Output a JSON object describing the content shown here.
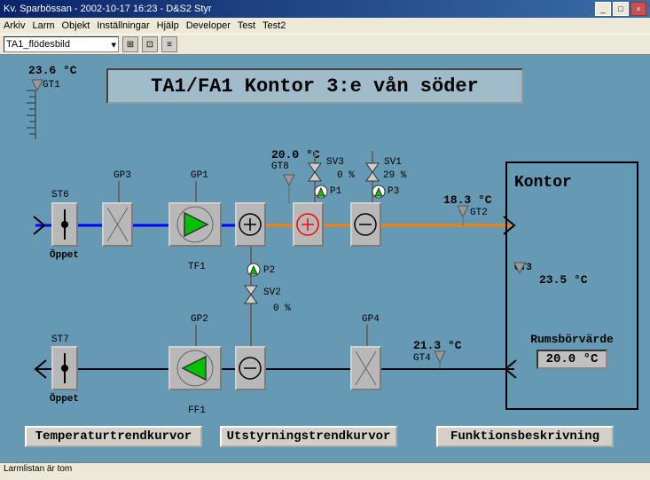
{
  "window": {
    "title": "Kv. Sparbössan  -  2002-10-17 16:23  -  D&S2 Styr",
    "min": "_",
    "max": "□",
    "close": "×"
  },
  "menu": [
    "Arkiv",
    "Larm",
    "Objekt",
    "Inställningar",
    "Hjälp",
    "Developer",
    "Test",
    "Test2"
  ],
  "toolbar": {
    "combo": "TA1_flödesbild",
    "combo_arrow": "▾"
  },
  "title": "TA1/FA1 Kontor 3:e vån söder",
  "outdoor": {
    "temp": "23.6 °C",
    "sensor": "GT1"
  },
  "supply": {
    "st6": "ST6",
    "st6_status": "Öppet",
    "gp3": "GP3",
    "gp1": "GP1",
    "tf1": "TF1",
    "gt8_temp": "20.0 °C",
    "gt8": "GT8",
    "sv3": "SV3",
    "sv3_pct": "0 %",
    "p1": "P1",
    "sv1": "SV1",
    "sv1_pct": "29 %",
    "p3": "P3",
    "gt2_temp": "18.3 °C",
    "gt2": "GT2",
    "p2": "P2",
    "sv2": "SV2",
    "sv2_pct": "0 %"
  },
  "return": {
    "st7": "ST7",
    "st7_status": "Öppet",
    "gp2": "GP2",
    "ff1": "FF1",
    "gp4": "GP4",
    "gt4_temp": "21.3 °C",
    "gt4": "GT4"
  },
  "room": {
    "title": "Kontor",
    "gt3": "GT3",
    "gt3_temp": "23.5 °C",
    "sp_label": "Rumsbörvärde",
    "sp": "20.0 °C"
  },
  "buttons": {
    "b1": "Temperaturtrendkurvor",
    "b2": "Utstyrningstrendkurvor",
    "b3": "Funktionsbeskrivning"
  },
  "status": "Larmlistan är tom"
}
